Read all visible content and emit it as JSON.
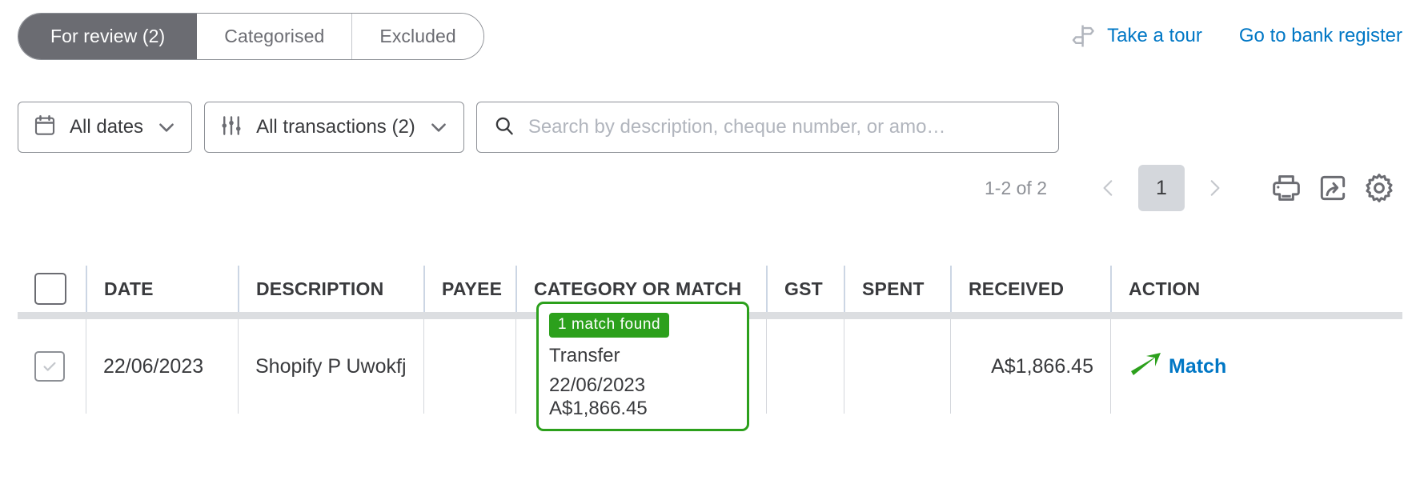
{
  "tabs": [
    {
      "label": "For review (2)",
      "active": true
    },
    {
      "label": "Categorised",
      "active": false
    },
    {
      "label": "Excluded",
      "active": false
    }
  ],
  "top_links": {
    "take_a_tour": "Take a tour",
    "bank_register": "Go to bank register"
  },
  "filters": {
    "dates": {
      "label": "All dates",
      "icon": "calendar-icon"
    },
    "transactions": {
      "label": "All transactions (2)",
      "icon": "sliders-icon"
    },
    "search": {
      "placeholder": "Search by description, cheque number, or amo…",
      "value": "",
      "icon": "search-icon"
    }
  },
  "pagination": {
    "range": "1-2 of 2",
    "prev": "‹",
    "current_page": "1",
    "next": "›",
    "icons": [
      "print-icon",
      "export-icon",
      "gear-icon"
    ]
  },
  "table": {
    "headers": [
      "DATE",
      "DESCRIPTION",
      "PAYEE",
      "CATEGORY OR MATCH",
      "GST",
      "SPENT",
      "RECEIVED",
      "ACTION"
    ],
    "rows": [
      {
        "selected": true,
        "date": "22/06/2023",
        "description": "Shopify P Uwokfj",
        "payee": "",
        "match": {
          "badge": "1 match found",
          "line1": "Transfer",
          "line2": "22/06/2023 A$1,866.45"
        },
        "gst": "",
        "spent": "",
        "received": "A$1,866.45",
        "action": "Match"
      }
    ]
  },
  "colors": {
    "link_blue": "#0077c5",
    "match_green": "#2ca01c",
    "active_tab_bg": "#6b6c72",
    "page_chip": "#d4d7dc"
  }
}
